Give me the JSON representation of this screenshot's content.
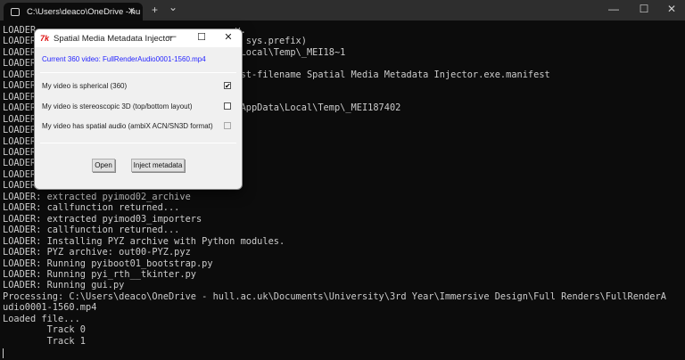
{
  "tabbar": {
    "tab_title": "C:\\Users\\deaco\\OneDrive - hu",
    "close": "✕",
    "new_tab": "+",
    "dropdown": "⌄",
    "minimize": "—",
    "maximize": "☐",
    "close_window": "✕"
  },
  "terminal": {
    "lines": [
      "LOADER                                    y.",
      "LOADER                                      sys.prefix)",
      "LOADER                                   a\\Local\\Temp\\_MEI18~1",
      "LOADER",
      "LOADER                                   fest-filename Spatial Media Metadata Injector.exe.manifest",
      "LOADER",
      "LOADER",
      "LOADER                                   o\\AppData\\Local\\Temp\\_MEI187402",
      "LOADER",
      "LOADER",
      "LOADER",
      "LOADER",
      "LOADER",
      "LOADER",
      "LOADER",
      "LOADER: extracted pyimod02_archive",
      "LOADER: callfunction returned...",
      "LOADER: extracted pyimod03_importers",
      "LOADER: callfunction returned...",
      "LOADER: Installing PYZ archive with Python modules.",
      "LOADER: PYZ archive: out00-PYZ.pyz",
      "LOADER: Running pyiboot01_bootstrap.py",
      "LOADER: Running pyi_rth__tkinter.py",
      "LOADER: Running gui.py",
      "Processing: C:\\Users\\deaco\\OneDrive - hull.ac.uk\\Documents\\University\\3rd Year\\Immersive Design\\Full Renders\\FullRenderA",
      "udio0001-1560.mp4",
      "Loaded file...",
      "        Track 0",
      "        Track 1"
    ]
  },
  "dialog": {
    "icon_text": "7k",
    "title": "Spatial Media Metadata Injector",
    "current_video": "Current 360 video: FullRenderAudio0001-1560.mp4",
    "options": [
      {
        "label": "My video is spherical (360)",
        "checked": true,
        "mark": "✔"
      },
      {
        "label": "My video is stereoscopic 3D (top/bottom layout)",
        "checked": false,
        "mark": ""
      },
      {
        "label": "My video has spatial audio (ambiX ACN/SN3D format)",
        "checked": false,
        "disabled": true,
        "mark": ""
      }
    ],
    "open_label": "Open",
    "inject_label": "Inject metadata",
    "minimize": "—",
    "maximize": "☐",
    "close": "✕"
  }
}
